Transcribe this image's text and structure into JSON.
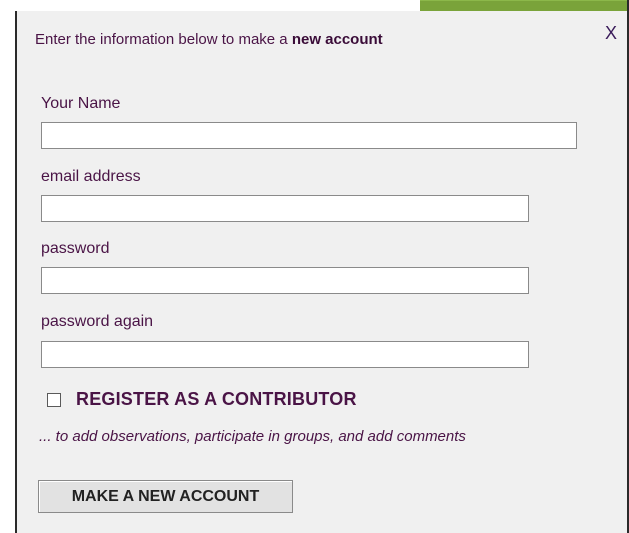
{
  "dialog": {
    "header_prefix": "Enter the information below to make a ",
    "header_emphasis": "new account",
    "close_label": "X"
  },
  "form": {
    "fields": [
      {
        "label": "Your Name",
        "value": ""
      },
      {
        "label": "email address",
        "value": ""
      },
      {
        "label": "password",
        "value": ""
      },
      {
        "label": "password again",
        "value": ""
      }
    ],
    "contributor": {
      "label": "REGISTER AS A CONTRIBUTOR",
      "checked": false,
      "description": "... to add observations, participate in groups, and add comments"
    },
    "submit_label": "MAKE A NEW ACCOUNT"
  },
  "colors": {
    "text": "#4a1446",
    "panel_bg": "#f0f0f0",
    "accent_green": "#7aa33a"
  }
}
